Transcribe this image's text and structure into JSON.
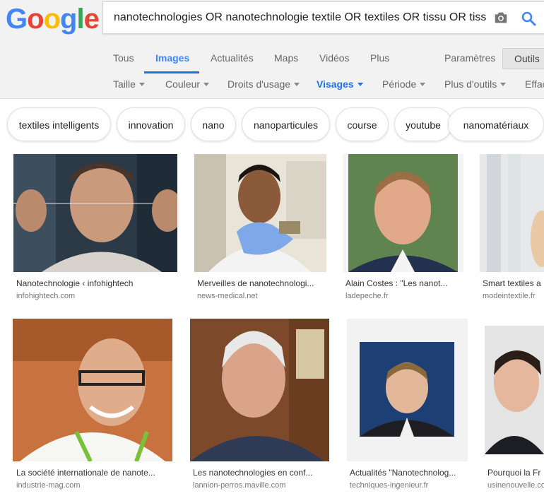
{
  "logo": {
    "text": "Google",
    "letters": [
      "G",
      "o",
      "o",
      "g",
      "l",
      "e"
    ],
    "colors": [
      "#4285f4",
      "#ea4335",
      "#fbbc05",
      "#4285f4",
      "#34a853",
      "#ea4335"
    ]
  },
  "search": {
    "query": "nanotechnologies OR nanotechnologie textile OR textiles OR tissu OR tiss",
    "camera_icon": "camera-icon",
    "search_icon": "search-icon"
  },
  "tabs": [
    "Tous",
    "Images",
    "Actualités",
    "Maps",
    "Vidéos",
    "Plus",
    "Paramètres",
    "Outils"
  ],
  "active_tab": "Images",
  "tools": [
    "Taille",
    "Couleur",
    "Droits d'usage",
    "Visages",
    "Période",
    "Plus d'outils",
    "Effac"
  ],
  "selected_tool": "Visages",
  "chips": [
    "textiles intelligents",
    "innovation",
    "nano",
    "nanoparticules",
    "course",
    "youtube",
    "nanomatériaux"
  ],
  "results": [
    {
      "caption": "Nanotechnologie ‹ infohightech",
      "source": "infohightech.com"
    },
    {
      "caption": "Merveilles de nanotechnologi...",
      "source": "news-medical.net"
    },
    {
      "caption": "Alain Costes : \"Les nanot...",
      "source": "ladepeche.fr"
    },
    {
      "caption": "Smart textiles a",
      "source": "modeintextile.fr"
    },
    {
      "caption": "La société internationale de nanote...",
      "source": "industrie-mag.com"
    },
    {
      "caption": "Les nanotechnologies en conf...",
      "source": "lannion-perros.maville.com"
    },
    {
      "caption": "Actualités \"Nanotechnolog...",
      "source": "techniques-ingenieur.fr"
    },
    {
      "caption": "Pourquoi la Fr",
      "source": "usinenouvelle.com"
    }
  ],
  "colors": {
    "accent": "#1a73e8",
    "header_bg": "#f2f2f2"
  }
}
